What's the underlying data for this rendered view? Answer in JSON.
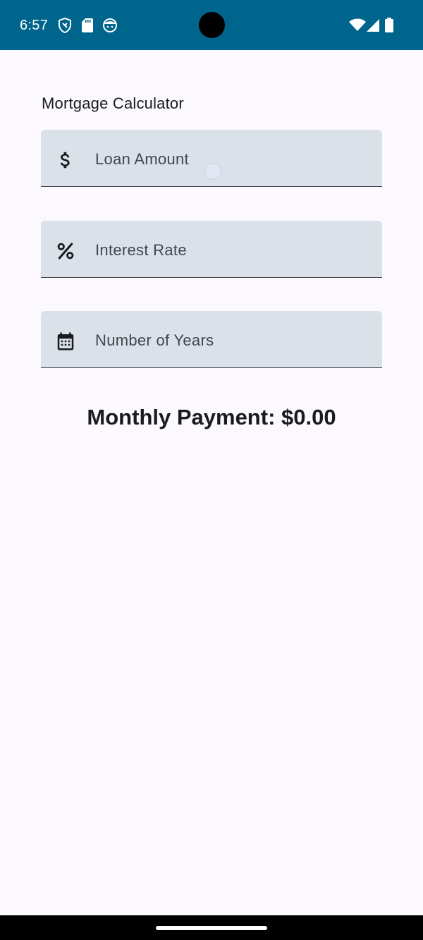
{
  "status_bar": {
    "time": "6:57",
    "left_icons": [
      "shield-icon",
      "sd-card-icon",
      "face-icon"
    ],
    "right_icons": [
      "wifi-icon",
      "signal-icon",
      "battery-icon"
    ],
    "background_color": "#00658c"
  },
  "header": {
    "title": "Mortgage Calculator"
  },
  "form": {
    "loan_amount": {
      "label": "Loan Amount",
      "icon": "dollar-icon"
    },
    "interest_rate": {
      "label": "Interest Rate",
      "icon": "percent-icon"
    },
    "number_of_years": {
      "label": "Number of Years",
      "icon": "calendar-icon"
    }
  },
  "result": {
    "text": "Monthly Payment: $0.00"
  },
  "colors": {
    "accent": "#00658c",
    "field_background": "#dae1e8",
    "page_background": "#fbf8fe",
    "text": "#1b1b1f"
  }
}
